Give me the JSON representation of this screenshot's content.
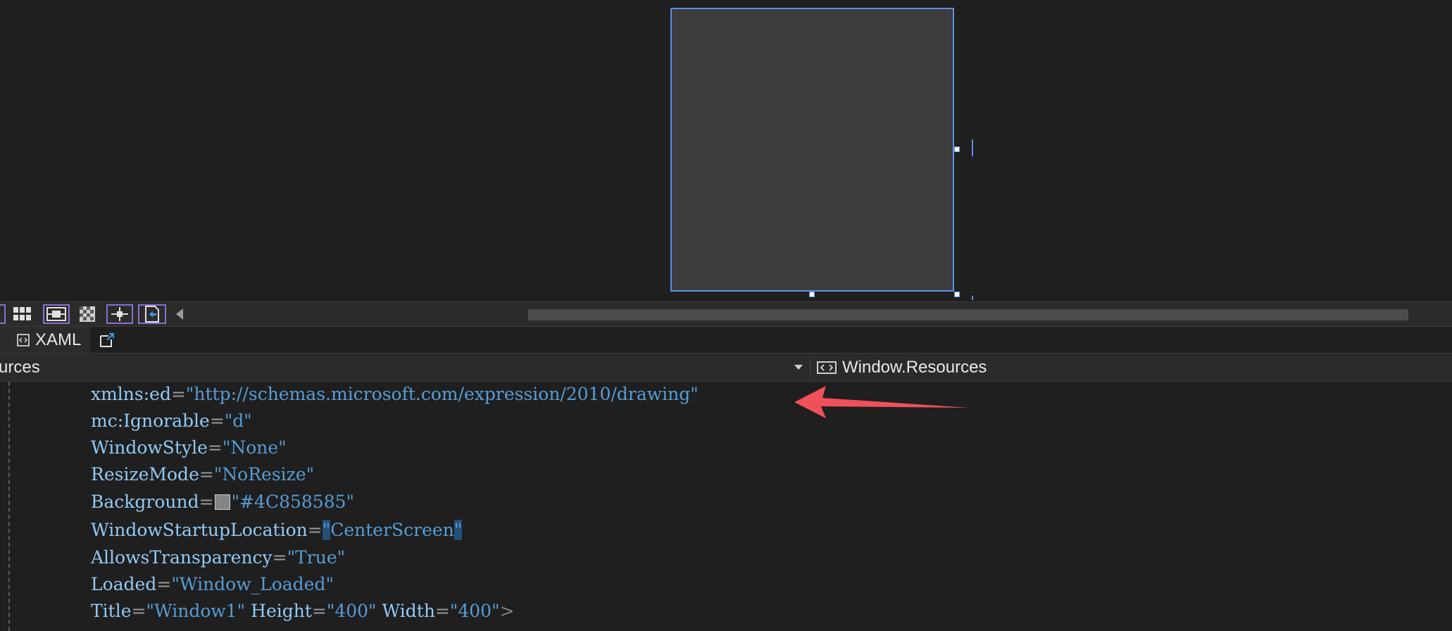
{
  "designer": {
    "toolbar": {
      "buttons": [
        {
          "icon": "artboard-edge-icon"
        },
        {
          "icon": "grid-icon"
        },
        {
          "icon": "snap-to-grid-icon"
        },
        {
          "icon": "checkerboard-icon"
        },
        {
          "icon": "snap-to-snaplines-icon"
        },
        {
          "icon": "device-preview-icon"
        }
      ]
    }
  },
  "tab_strip": {
    "active_tab": "XAML"
  },
  "nav_bar": {
    "left_dropdown_text": "urces",
    "right_dropdown_text": "Window.Resources"
  },
  "code": {
    "lines": [
      {
        "attr": "xmlns:ed",
        "value": "\"http://schemas.microsoft.com/expression/2010/drawing\""
      },
      {
        "attr": "mc:Ignorable",
        "value": "\"d\""
      },
      {
        "attr": "WindowStyle",
        "value": "\"None\""
      },
      {
        "attr": "ResizeMode",
        "value": "\"NoResize\""
      },
      {
        "attr": "Background",
        "value": "\"#4C858585\"",
        "swatch_color": "#858585"
      },
      {
        "attr": "WindowStartupLocation",
        "value": "CenterScreen",
        "quote": "\""
      },
      {
        "attr": "AllowsTransparency",
        "value": "\"True\""
      },
      {
        "attr": "Loaded",
        "value": "\"Window_Loaded\""
      },
      {
        "attr": "Title",
        "value": "\"Window1\"",
        "attr2": "Height",
        "value2": "\"400\"",
        "attr3": "Width",
        "value3": "\"400\"",
        "close": ">"
      }
    ]
  },
  "colors": {
    "background": "#1f1f1f",
    "selection": "#5b8fe6",
    "attribute": "#92caf4",
    "string": "#569cd6",
    "annotation_arrow": "#f0505a"
  }
}
